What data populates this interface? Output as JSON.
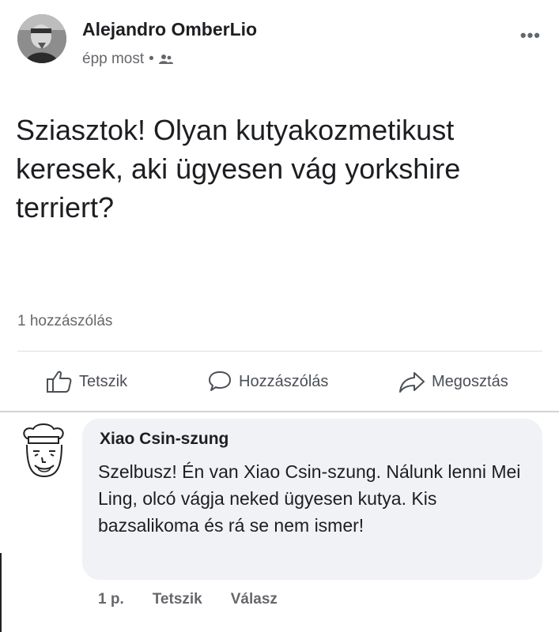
{
  "post": {
    "author": "Alejandro OmberLio",
    "time": "épp most",
    "separator": "•",
    "audience_icon": "friends-icon",
    "more_icon": "•••",
    "text": "Sziasztok! Olyan kutyakozmetikust keresek, aki ügyesen vág yorkshire terriert?",
    "comment_count": "1 hozzászólás"
  },
  "actions": {
    "like": "Tetszik",
    "comment": "Hozzászólás",
    "share": "Megosztás"
  },
  "comment": {
    "author": "Xiao Csin-szung",
    "text": "Szelbusz! Én van Xiao Csin-szung. Nálunk lenni Mei Ling, olcó vágja neked ügyesen kutya. Kis bazsalikoma és rá se nem ismer!",
    "time": "1 p.",
    "like": "Tetszik",
    "reply": "Válasz"
  },
  "colors": {
    "text": "#1c1e21",
    "secondary": "#65676b",
    "bubble": "#f0f2f5"
  }
}
